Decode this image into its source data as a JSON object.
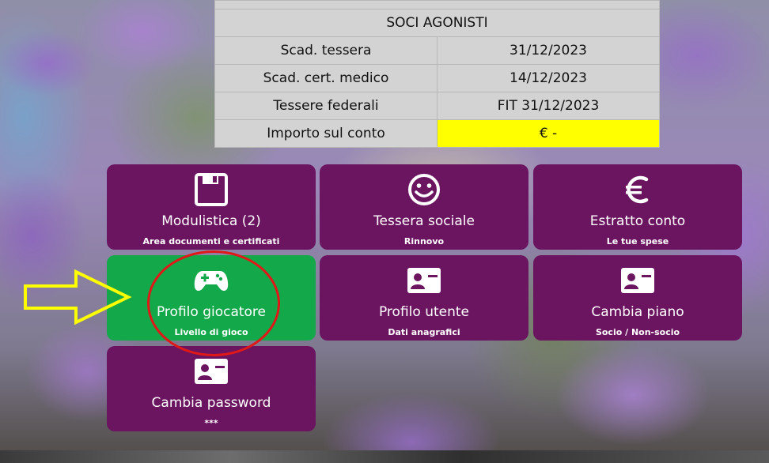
{
  "membership": {
    "header": "SOCI AGONISTI",
    "rows": [
      {
        "label": "Scad. tessera",
        "value": "31/12/2023"
      },
      {
        "label": "Scad. cert. medico",
        "value": "14/12/2023"
      },
      {
        "label": "Tessere federali",
        "value": "FIT 31/12/2023"
      },
      {
        "label": "Importo sul conto",
        "value": "€ -"
      }
    ]
  },
  "tiles": [
    {
      "title": "Modulistica (2)",
      "subtitle": "Area documenti e certificati",
      "icon": "floppy-disk-icon"
    },
    {
      "title": "Tessera sociale",
      "subtitle": "Rinnovo",
      "icon": "smiley-icon"
    },
    {
      "title": "Estratto conto",
      "subtitle": "Le tue spese",
      "icon": "euro-icon"
    },
    {
      "title": "Profilo giocatore",
      "subtitle": "Livello di gioco",
      "icon": "gamepad-icon"
    },
    {
      "title": "Profilo utente",
      "subtitle": "Dati anagrafici",
      "icon": "id-card-icon"
    },
    {
      "title": "Cambia piano",
      "subtitle": "Socio / Non-socio",
      "icon": "id-card-icon"
    },
    {
      "title": "Cambia password",
      "subtitle": "***",
      "icon": "id-card-icon"
    }
  ],
  "colors": {
    "tile": "#6b1460",
    "tile_active": "#13a84a",
    "amount_highlight": "#ffff00",
    "annotation_arrow": "#ffff00",
    "annotation_circle": "#e01818"
  }
}
